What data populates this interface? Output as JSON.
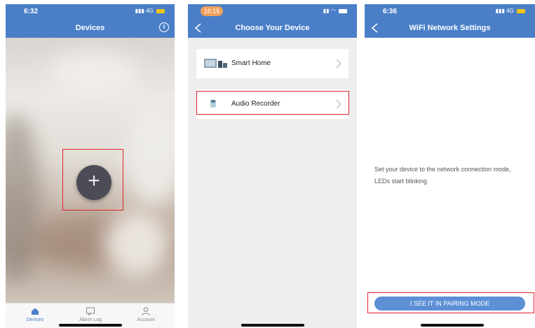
{
  "screen1": {
    "status_time": "6:32",
    "status_network": "4G",
    "title": "Devices",
    "info_icon": "info-icon",
    "add_symbol": "+",
    "tabs": [
      {
        "label": "Devices",
        "icon": "home-icon",
        "active": true
      },
      {
        "label": "Alarm Log",
        "icon": "message-icon",
        "active": false
      },
      {
        "label": "Account",
        "icon": "user-icon",
        "active": false
      }
    ]
  },
  "screen2": {
    "status_time": "16:15",
    "title": "Choose Your Device",
    "devices": [
      {
        "label": "Smart Home",
        "icon": "smart-home-device-icon"
      },
      {
        "label": "Audio Recorder",
        "icon": "audio-recorder-device-icon"
      }
    ]
  },
  "screen3": {
    "status_time": "6:36",
    "status_network": "4G",
    "title": "WiFi Network Settings",
    "instruction": "Set your device to the network connection mode, LEDs start blinking",
    "button_label": "I SEE IT IN PAIRING MODE"
  },
  "colors": {
    "header": "#4a7fc8",
    "highlight": "#e1262b",
    "button": "#5c8fd6"
  }
}
